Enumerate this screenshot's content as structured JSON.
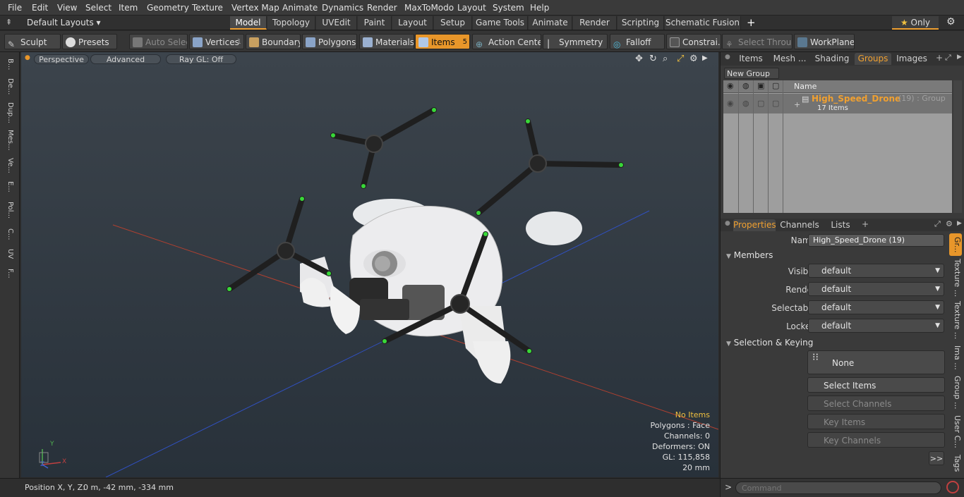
{
  "menubar": {
    "items": [
      "File",
      "Edit",
      "View",
      "Select",
      "Item",
      "Geometry",
      "Texture",
      "Vertex Map",
      "Animate",
      "Dynamics",
      "Render",
      "MaxToModo",
      "Layout",
      "System",
      "Help"
    ]
  },
  "layoutbar": {
    "layouts_label": "Default Layouts",
    "tabs": [
      "Model",
      "Topology",
      "UVEdit",
      "Paint",
      "Layout",
      "Setup",
      "Game Tools",
      "Animate",
      "Render",
      "Scripting",
      "Schematic Fusion"
    ],
    "active_tab": "Model",
    "add_label": "+",
    "only_label": "Only"
  },
  "toolbar": {
    "sculpt": "Sculpt",
    "presets": "Presets",
    "auto_select": "Auto Select",
    "vertices": "Vertices",
    "vertices_count": "1",
    "boundary": "Boundary",
    "polygons": "Polygons",
    "materials": "Materials",
    "items": "Items",
    "items_count": "5",
    "action_center": "Action Center",
    "symmetry": "Symmetry",
    "falloff": "Falloff",
    "constraints": "Constrai...",
    "select_through": "Select Through",
    "workplane": "WorkPlane"
  },
  "lefttabs": [
    "B...",
    "De...",
    "Dup...",
    "Mes...",
    "Ve...",
    "E...",
    "Pol...",
    "C...",
    "UV",
    "F..."
  ],
  "viewport": {
    "perspective": "Perspective",
    "advanced": "Advanced",
    "raygl": "Ray GL: Off",
    "info": {
      "no_items": "No Items",
      "polygons": "Polygons : Face",
      "channels": "Channels: 0",
      "deformers": "Deformers: ON",
      "gl": "GL: 115,858",
      "scale": "20 mm"
    },
    "axes": {
      "y": "Y",
      "x": "X",
      "z": "Z"
    }
  },
  "statusbar": {
    "position_label": "Position X, Y, Z:",
    "position_value": "0 m, -42 mm, -334 mm"
  },
  "rightpanel": {
    "top_tabs": [
      "Items",
      "Mesh ...",
      "Shading",
      "Groups",
      "Images"
    ],
    "active_top_tab": "Groups",
    "new_group": "New Group",
    "list_header_name": "Name",
    "group_name": "High_Speed_Drone",
    "group_suffix": "(19) : Group",
    "group_items": "17 Items",
    "prop_tabs": [
      "Properties",
      "Channels",
      "Lists"
    ],
    "active_prop_tab": "Properties",
    "name_label": "Name",
    "name_value": "High_Speed_Drone (19)",
    "members_label": "Members",
    "visible_label": "Visible",
    "visible_value": "default",
    "render_label": "Render",
    "render_value": "default",
    "selectable_label": "Selectable",
    "selectable_value": "default",
    "locked_label": "Locked",
    "locked_value": "default",
    "sel_keying_label": "Selection & Keying",
    "none_label": "None",
    "select_items": "Select Items",
    "select_channels": "Select Channels",
    "key_items": "Key Items",
    "key_channels": "Key Channels",
    "expand_label": ">>",
    "side_tabs": [
      "Gr...",
      "Texture ...",
      "Texture ...",
      "Ima ...",
      "Group ...",
      "User C...",
      "Tags"
    ],
    "command_placeholder": "Command",
    "command_prompt": ">"
  },
  "colors": {
    "accent": "#f0a030",
    "items_active": "#e8962a",
    "group_text": "#f0a030"
  }
}
